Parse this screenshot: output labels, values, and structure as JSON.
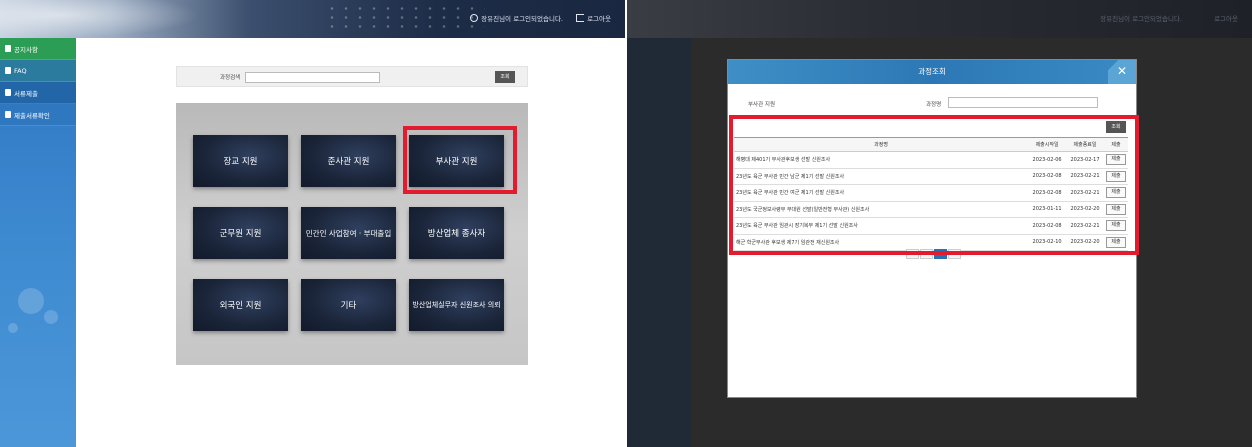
{
  "left": {
    "topbar": {
      "user_text": "장유진님이 로그인되었습니다.",
      "logout_label": "로그아웃"
    },
    "sidebar": {
      "items": [
        {
          "label": "공지사항"
        },
        {
          "label": "FAQ"
        },
        {
          "label": "서류제출"
        },
        {
          "label": "제출서류확인"
        }
      ]
    },
    "search": {
      "label": "과정검색",
      "value": "",
      "button_label": "조회"
    },
    "tiles": [
      {
        "label": "장교 지원"
      },
      {
        "label": "준사관 지원"
      },
      {
        "label": "부사관 지원"
      },
      {
        "label": "군무원 지원"
      },
      {
        "label": "민간인 사업참여 · 부대출입"
      },
      {
        "label": "방산업체 종사자"
      },
      {
        "label": "외국인 지원"
      },
      {
        "label": "기타"
      },
      {
        "label": "방산업체실무자 신원조사 의뢰"
      }
    ]
  },
  "right": {
    "modal": {
      "title": "과정조회",
      "close": "✕",
      "filter_label": "부사관 지원",
      "course_label": "과정명",
      "search_button": "조회",
      "columns": [
        "과정명",
        "제출시작일",
        "제출종료일",
        "제출"
      ],
      "rows": [
        {
          "name": "해병대 제401기 부사관후보생 선발 신원조사",
          "start": "2023-02-06",
          "end": "2023-02-17",
          "action": "제출"
        },
        {
          "name": "23년도 육군 부사관 민간 남군 제1기 선발 신원조사",
          "start": "2023-02-08",
          "end": "2023-02-21",
          "action": "제출"
        },
        {
          "name": "23년도 육군 부사관 민간 여군 제1기 선발 신원조사",
          "start": "2023-02-08",
          "end": "2023-02-21",
          "action": "제출"
        },
        {
          "name": "23년도 국군정보사령부 부대원 선발(일반전형 부사관) 신원조사",
          "start": "2023-01-11",
          "end": "2023-02-20",
          "action": "제출"
        },
        {
          "name": "23년도 육군 부사관 임관시 장기복무 제1기 선발 신원조사",
          "start": "2023-02-08",
          "end": "2023-02-21",
          "action": "제출"
        },
        {
          "name": "해군 학군부사관 후보생 제7기 임관전 재신원조사",
          "start": "2023-02-10",
          "end": "2023-02-20",
          "action": "제출"
        }
      ]
    }
  },
  "colors": {
    "highlight": "#e21c2e",
    "sidebar": "#3e8ad0",
    "modal_header": "#2c78b6",
    "tile": "#1a2438"
  }
}
